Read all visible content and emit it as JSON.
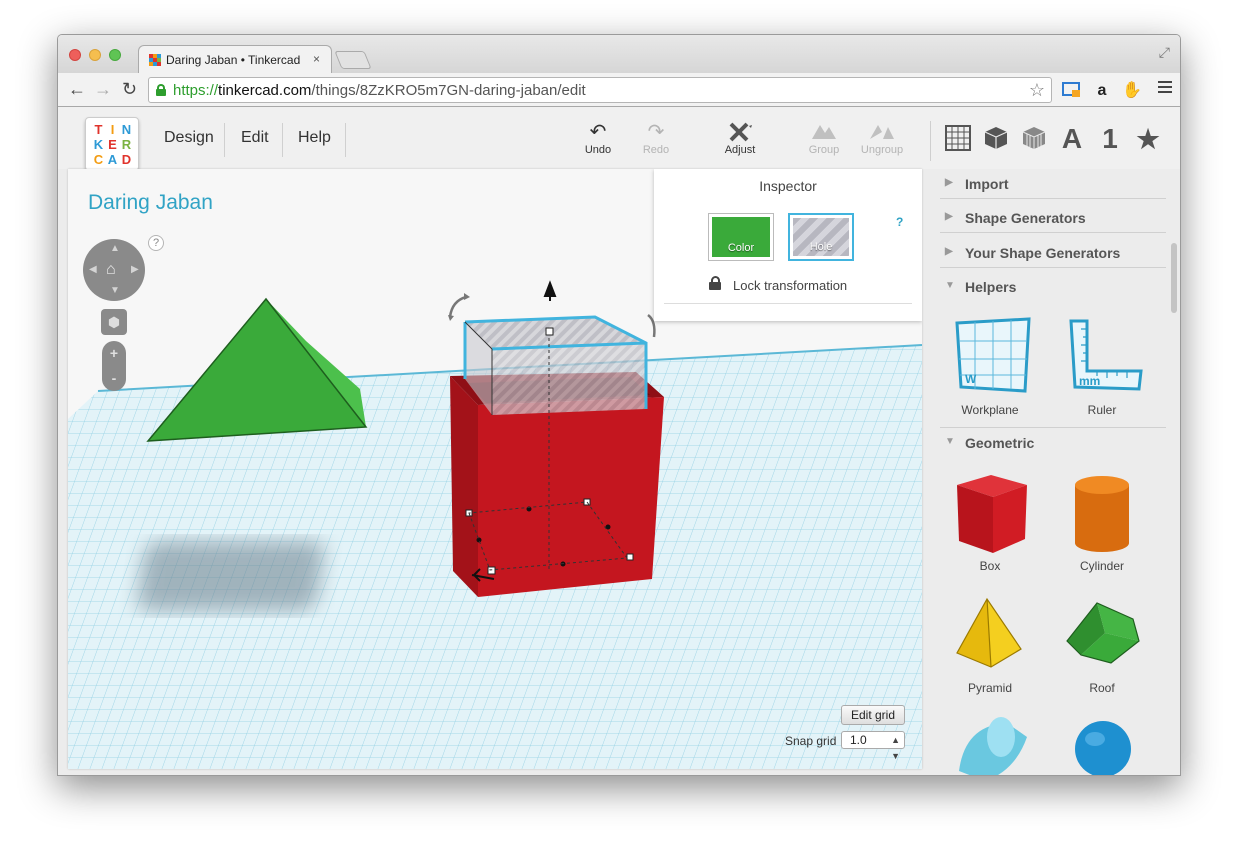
{
  "browser": {
    "tab_title": "Daring Jaban • Tinkercad",
    "tab_close": "×",
    "url_scheme": "https://",
    "url_domain": "tinkercad.com",
    "url_path": "/things/8ZzKRO5m7GN-daring-jaban/edit",
    "icons": [
      "back-icon",
      "forward-icon",
      "reload-icon",
      "bookmark-star-icon",
      "cast-icon",
      "amazon-icon",
      "extension-icon",
      "menu-icon"
    ]
  },
  "logo": {
    "letters": [
      "T",
      "I",
      "N",
      "K",
      "E",
      "R",
      "C",
      "A",
      "D"
    ],
    "colors": [
      "#e0332c",
      "#f39c12",
      "#2e9ad6",
      "#2e9ad6",
      "#e0332c",
      "#7cb342",
      "#f39c12",
      "#2e9ad6",
      "#e0332c"
    ]
  },
  "menu": {
    "design": "Design",
    "edit": "Edit",
    "help": "Help"
  },
  "tools": {
    "undo": "Undo",
    "redo": "Redo",
    "adjust": "Adjust",
    "group": "Group",
    "ungroup": "Ungroup"
  },
  "view_icons": {
    "text": "A",
    "number": "1"
  },
  "canvas": {
    "title": "Daring Jaban",
    "help": "?",
    "edit_grid": "Edit grid",
    "snap_grid_label": "Snap grid",
    "snap_grid_value": "1.0"
  },
  "inspector": {
    "title": "Inspector",
    "color_label": "Color",
    "hole_label": "Hole",
    "help": "?",
    "lock_label": "Lock transformation",
    "color_value": "#3aaa3a"
  },
  "panel": {
    "sections": {
      "import": "Import",
      "shape_generators": "Shape Generators",
      "your_shape_generators": "Your Shape Generators",
      "helpers": "Helpers",
      "geometric": "Geometric"
    },
    "helpers": [
      {
        "label": "Workplane"
      },
      {
        "label": "Ruler"
      }
    ],
    "helper_marks": {
      "workplane": "W",
      "ruler": "mm"
    },
    "geometric": [
      {
        "label": "Box"
      },
      {
        "label": "Cylinder"
      },
      {
        "label": "Pyramid"
      },
      {
        "label": "Roof"
      }
    ]
  },
  "colors": {
    "accent": "#30a3c5",
    "box_red": "#c4161f",
    "roof_green": "#3aaa3a"
  }
}
